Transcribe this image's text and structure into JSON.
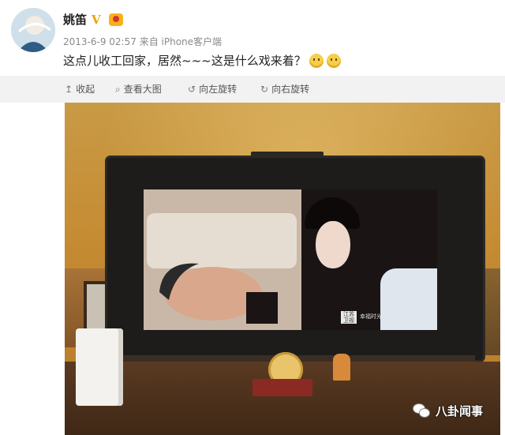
{
  "post": {
    "author": "姚笛",
    "timestamp": "2013-6-9 02:57",
    "source": "来自 iPhone客户端",
    "text": "这点儿收工回家，居然~~~这是什么戏来着？",
    "emojis": [
      "smile-emoji",
      "thinking-emoji"
    ]
  },
  "actions": {
    "collapse": "收起",
    "view_large": "查看大图",
    "rotate_left": "向左旋转",
    "rotate_right": "向右旋转"
  },
  "photo": {
    "tv_logo": "江苏卫视",
    "tv_logo_sub": "幸福时光"
  },
  "watermark": {
    "text": "八卦闻事"
  },
  "colors": {
    "header_bg": "#ffffff",
    "action_bar_bg": "#f2f2f2",
    "vip_badge": "#f2a007",
    "meta_text": "#8a8a8a"
  }
}
